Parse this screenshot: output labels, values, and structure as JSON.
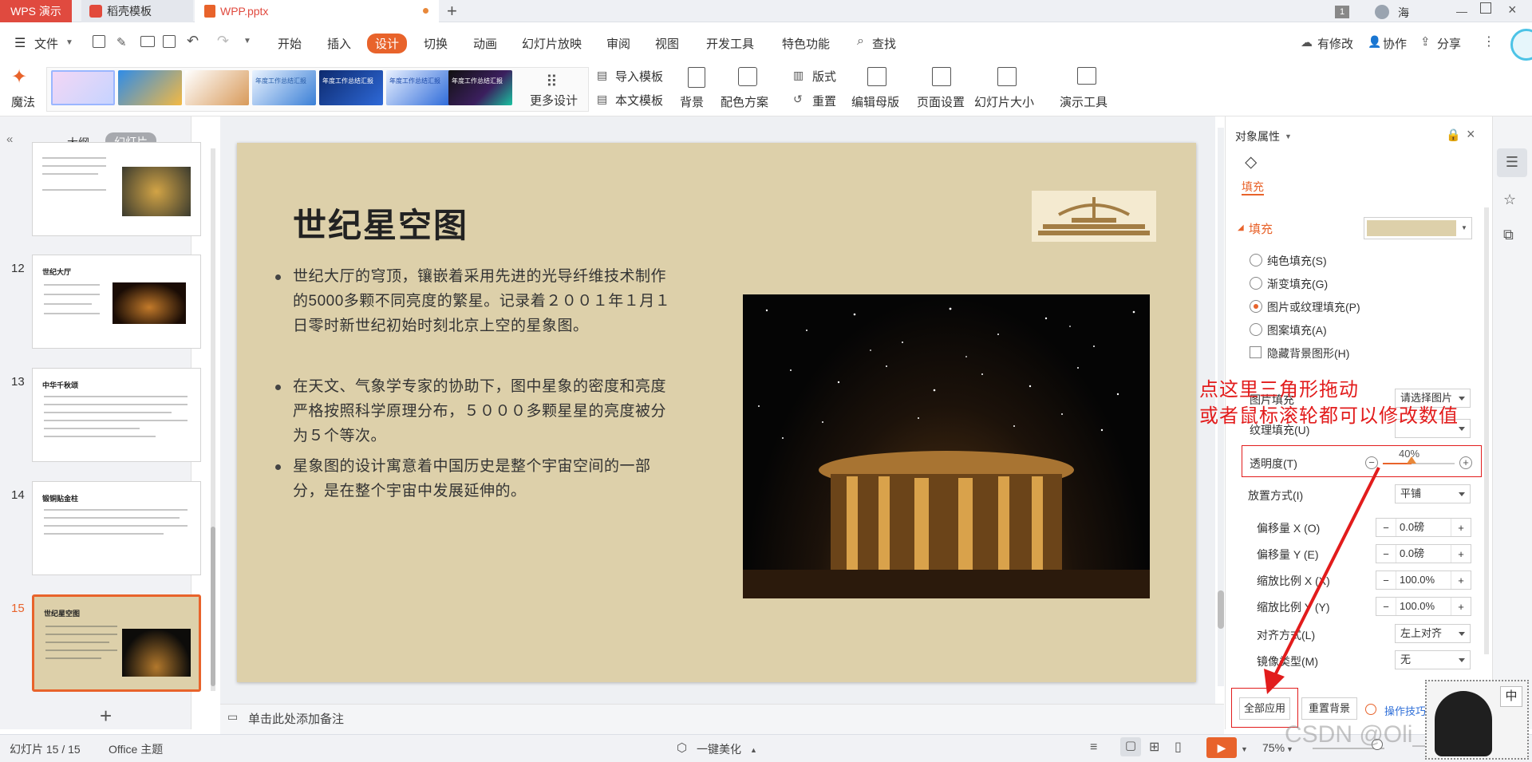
{
  "titlebar": {
    "app_tab": "WPS 演示",
    "tab2": "稻壳模板",
    "tab3": "WPP.pptx",
    "new_tab": "+",
    "badge": "1",
    "user": "海"
  },
  "menu": {
    "file": "文件",
    "items": [
      "开始",
      "插入",
      "设计",
      "切换",
      "动画",
      "幻灯片放映",
      "审阅",
      "视图",
      "开发工具",
      "特色功能"
    ],
    "active": "设计",
    "search": "查找",
    "has_change": "有修改",
    "collab": "协作",
    "share": "分享"
  },
  "ribbon": {
    "magic": "魔法",
    "more_design": "更多设计",
    "import_tpl": "导入模板",
    "this_tpl": "本文模板",
    "background": "背景",
    "color_scheme": "配色方案",
    "layout": "版式",
    "reset": "重置",
    "edit_master": "编辑母版",
    "page_setup": "页面设置",
    "slide_size": "幻灯片大小",
    "presenter_tools": "演示工具",
    "tpl_texts": [
      "年度工作总结汇报",
      "年度工作总结汇报",
      "年度工作总结汇报",
      "年度工作总结汇报"
    ]
  },
  "leftpane": {
    "tab_outline": "大纲",
    "tab_slides": "幻灯片",
    "slides": [
      {
        "num": "12",
        "title": "世纪大厅"
      },
      {
        "num": "13",
        "title": "中华千秋颂"
      },
      {
        "num": "14",
        "title": "锻铜贴金柱"
      },
      {
        "num": "15",
        "title": "世纪星空图"
      }
    ],
    "add": "+"
  },
  "slide": {
    "title": "世纪星空图",
    "bullets": [
      "世纪大厅的穹顶，镶嵌着采用先进的光导纤维技术制作的5000多颗不同亮度的繁星。记录着２００１年１月１日零时新世纪初始时刻北京上空的星象图。",
      "在天文、气象学专家的协助下，图中星象的密度和亮度严格按照科学原理分布，５０００多颗星星的亮度被分为５个等次。",
      "星象图的设计寓意着中国历史是整个宇宙空间的一部分，是在整个宇宙中发展延伸的。"
    ]
  },
  "notes": {
    "placeholder": "单击此处添加备注"
  },
  "props": {
    "header": "对象属性",
    "tab_fill": "填充",
    "section_fill": "填充",
    "options": [
      "纯色填充(S)",
      "渐变填充(G)",
      "图片或纹理填充(P)",
      "图案填充(A)"
    ],
    "selected_option": "图片或纹理填充(P)",
    "hide_bg": "隐藏背景图形(H)",
    "pic_fill": "图片填充",
    "pic_select": "请选择图片",
    "texture_fill": "纹理填充(U)",
    "transparency_label": "透明度(T)",
    "transparency_value": "40%",
    "transparency": 0.4,
    "placement_label": "放置方式(I)",
    "placement_value": "平铺",
    "offset_x_label": "偏移量 X (O)",
    "offset_x": "0.0磅",
    "offset_y_label": "偏移量 Y (E)",
    "offset_y": "0.0磅",
    "scale_x_label": "缩放比例 X (X)",
    "scale_x": "100.0%",
    "scale_y_label": "缩放比例 Y (Y)",
    "scale_y": "100.0%",
    "align_label": "对齐方式(L)",
    "align_value": "左上对齐",
    "mirror_label": "镜像类型(M)",
    "mirror_value": "无",
    "apply_all": "全部应用",
    "reset_bg": "重置背景",
    "tips": "操作技巧"
  },
  "annotation": {
    "line1": "点这里三角形拖动",
    "line2": "或者鼠标滚轮都可以修改数值"
  },
  "status": {
    "slide_count": "幻灯片 15 / 15",
    "theme": "Office 主题",
    "beautify": "一键美化",
    "zoom": "75%",
    "watermark": "CSDN @Oli_Correct",
    "ime": "中"
  },
  "colors": {
    "accent": "#e8632b",
    "annotation": "#e21c1c",
    "slide_bg": "#ddd0aa"
  }
}
